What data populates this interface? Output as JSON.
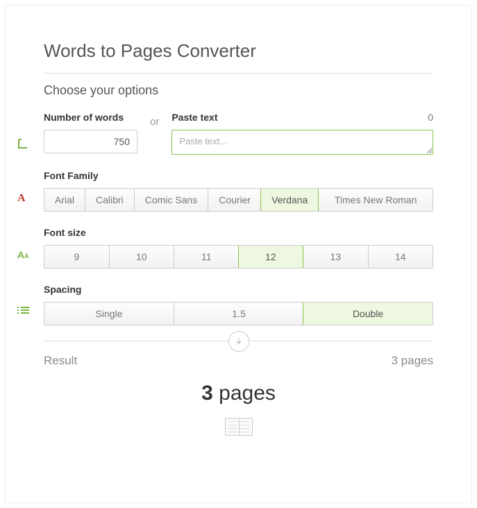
{
  "title": "Words to Pages Converter",
  "subtitle": "Choose your options",
  "words": {
    "label": "Number of words",
    "value": "750"
  },
  "paste": {
    "label": "Paste text",
    "count": "0",
    "placeholder": "Paste text..."
  },
  "or_label": "or",
  "fontFamily": {
    "label": "Font Family",
    "options": [
      "Arial",
      "Calibri",
      "Comic Sans",
      "Courier",
      "Verdana",
      "Times New Roman"
    ],
    "selected": "Verdana"
  },
  "fontSize": {
    "label": "Font size",
    "options": [
      "9",
      "10",
      "11",
      "12",
      "13",
      "14"
    ],
    "selected": "12"
  },
  "spacing": {
    "label": "Spacing",
    "options": [
      "Single",
      "1.5",
      "Double"
    ],
    "selected": "Double"
  },
  "result": {
    "label": "Result",
    "summary": "3 pages",
    "big_number": "3",
    "big_unit": "pages"
  }
}
